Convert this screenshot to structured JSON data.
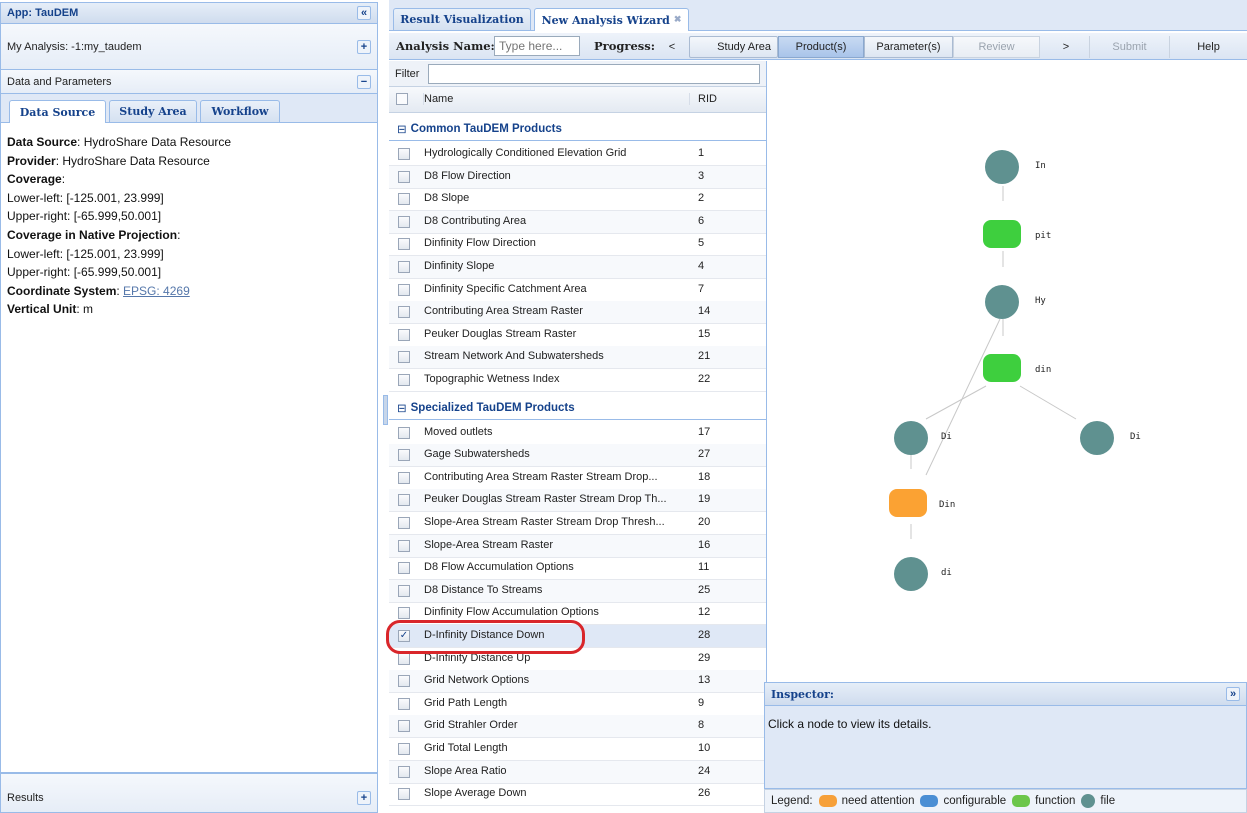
{
  "left": {
    "app_title": "App: TauDEM",
    "my_analysis": "My Analysis: -1:my_taudem",
    "data_params": "Data and Parameters",
    "tabs": [
      "Data Source",
      "Study Area",
      "Workflow"
    ],
    "results": "Results",
    "info": {
      "ds_label": "Data Source",
      "ds_value": ": HydroShare Data Resource",
      "prov_label": "Provider",
      "prov_value": ": HydroShare Data Resource",
      "cov_label": "Coverage",
      "cov_value": ":",
      "ll1": "Lower-left: [-125.001, 23.999]",
      "ur1": "Upper-right: [-65.999,50.001]",
      "native_label": "Coverage in Native Projection",
      "native_value": ":",
      "ll2": "Lower-left: [-125.001, 23.999]",
      "ur2": "Upper-right: [-65.999,50.001]",
      "cs_label": "Coordinate System",
      "cs_value": ": ",
      "cs_link": "EPSG: 4269",
      "vu_label": "Vertical Unit",
      "vu_value": ": m"
    }
  },
  "top_tabs": [
    "Result Visualization",
    "New Analysis Wizard"
  ],
  "wizard": {
    "name_label": "Analysis Name:",
    "name_placeholder": "Type here...",
    "progress_label": "Progress:",
    "prev": "<",
    "steps": [
      "Study Area",
      "Product(s)",
      "Parameter(s)",
      "Review"
    ],
    "next": ">",
    "submit": "Submit",
    "help": "Help"
  },
  "grid": {
    "filter_label": "Filter",
    "col_name": "Name",
    "col_rid": "RID",
    "groups": [
      {
        "title": "Common TauDEM Products",
        "rows": [
          {
            "name": "Hydrologically Conditioned Elevation Grid",
            "rid": "1"
          },
          {
            "name": "D8 Flow Direction",
            "rid": "3"
          },
          {
            "name": "D8 Slope",
            "rid": "2"
          },
          {
            "name": "D8 Contributing Area",
            "rid": "6"
          },
          {
            "name": "Dinfinity Flow Direction",
            "rid": "5"
          },
          {
            "name": "Dinfinity Slope",
            "rid": "4"
          },
          {
            "name": "Dinfinity Specific Catchment Area",
            "rid": "7"
          },
          {
            "name": "Contributing Area Stream Raster",
            "rid": "14"
          },
          {
            "name": "Peuker Douglas Stream Raster",
            "rid": "15"
          },
          {
            "name": "Stream Network And Subwatersheds",
            "rid": "21"
          },
          {
            "name": "Topographic Wetness Index",
            "rid": "22"
          }
        ]
      },
      {
        "title": "Specialized TauDEM Products",
        "rows": [
          {
            "name": "Moved outlets",
            "rid": "17"
          },
          {
            "name": "Gage Subwatersheds",
            "rid": "27"
          },
          {
            "name": "Contributing Area Stream Raster Stream Drop...",
            "rid": "18"
          },
          {
            "name": "Peuker Douglas Stream Raster Stream Drop Th...",
            "rid": "19"
          },
          {
            "name": "Slope-Area Stream Raster Stream Drop Thresh...",
            "rid": "20"
          },
          {
            "name": "Slope-Area Stream Raster",
            "rid": "16"
          },
          {
            "name": "D8 Flow Accumulation Options",
            "rid": "11"
          },
          {
            "name": "D8 Distance To Streams",
            "rid": "25"
          },
          {
            "name": "Dinfinity Flow Accumulation Options",
            "rid": "12"
          },
          {
            "name": "D-Infinity Distance Down",
            "rid": "28",
            "checked": true
          },
          {
            "name": "D-Infinity Distance Up",
            "rid": "29"
          },
          {
            "name": "Grid Network Options",
            "rid": "13"
          },
          {
            "name": "Grid Path Length",
            "rid": "9"
          },
          {
            "name": "Grid Strahler Order",
            "rid": "8"
          },
          {
            "name": "Grid Total Length",
            "rid": "10"
          },
          {
            "name": "Slope Area Ratio",
            "rid": "24"
          },
          {
            "name": "Slope Average Down",
            "rid": "26"
          }
        ]
      }
    ]
  },
  "graph": {
    "nodes": [
      {
        "id": "n-in",
        "label": "In",
        "kind": "file"
      },
      {
        "id": "n-pit",
        "label": "pit",
        "kind": "function"
      },
      {
        "id": "n-hy",
        "label": "Hy",
        "kind": "file"
      },
      {
        "id": "n-din",
        "label": "din",
        "kind": "function"
      },
      {
        "id": "n-di-left",
        "label": "Di",
        "kind": "file"
      },
      {
        "id": "n-di-right",
        "label": "Di",
        "kind": "file"
      },
      {
        "id": "n-din-attn",
        "label": "Din",
        "kind": "need attention"
      },
      {
        "id": "n-di-bottom",
        "label": "di",
        "kind": "file"
      }
    ]
  },
  "inspector": {
    "title": "Inspector:",
    "message": "Click a node to view its details."
  },
  "legend": {
    "label": "Legend:",
    "items": [
      {
        "text": "need attention",
        "color": "#f6a03a"
      },
      {
        "text": "configurable",
        "color": "#4a8ed4"
      },
      {
        "text": "function",
        "color": "#6cc64a"
      },
      {
        "text": "file",
        "color": "#5f9190"
      }
    ]
  },
  "colors": {
    "file": "#5f9190",
    "function": "#3ecf3e",
    "attention": "#fba233",
    "highlight": "#d9262a"
  }
}
